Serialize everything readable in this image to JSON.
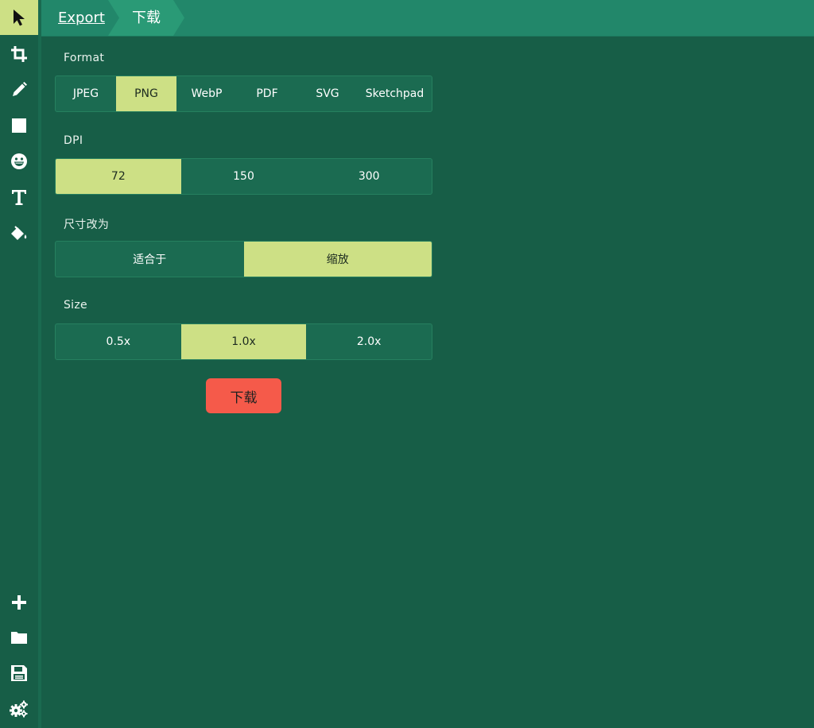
{
  "header": {
    "breadcrumb_root": "Export",
    "breadcrumb_current": "下载"
  },
  "sidebar": {
    "top_tools": [
      {
        "icon": "pointer-icon",
        "active": true
      },
      {
        "icon": "crop-icon"
      },
      {
        "icon": "pencil-icon"
      },
      {
        "icon": "rectangle-icon"
      },
      {
        "icon": "emoji-icon"
      },
      {
        "icon": "text-icon"
      },
      {
        "icon": "paint-bucket-icon"
      }
    ],
    "bottom_tools": [
      {
        "icon": "plus-icon"
      },
      {
        "icon": "folder-icon"
      },
      {
        "icon": "save-icon"
      },
      {
        "icon": "settings-icon"
      }
    ]
  },
  "export": {
    "format": {
      "label": "Format",
      "options": [
        "JPEG",
        "PNG",
        "WebP",
        "PDF",
        "SVG",
        "Sketchpad"
      ],
      "selected": "PNG"
    },
    "dpi": {
      "label": "DPI",
      "options": [
        "72",
        "150",
        "300"
      ],
      "selected": "72"
    },
    "resize": {
      "label": "尺寸改为",
      "options": [
        "适合于",
        "缩放"
      ],
      "selected": "缩放"
    },
    "size": {
      "label": "Size",
      "options": [
        "0.5x",
        "1.0x",
        "2.0x"
      ],
      "selected": "1.0x"
    },
    "download_label": "下载"
  },
  "colors": {
    "background": "#175e47",
    "header": "#22876a",
    "selected": "#cde085",
    "download_button": "#f55a4a"
  }
}
